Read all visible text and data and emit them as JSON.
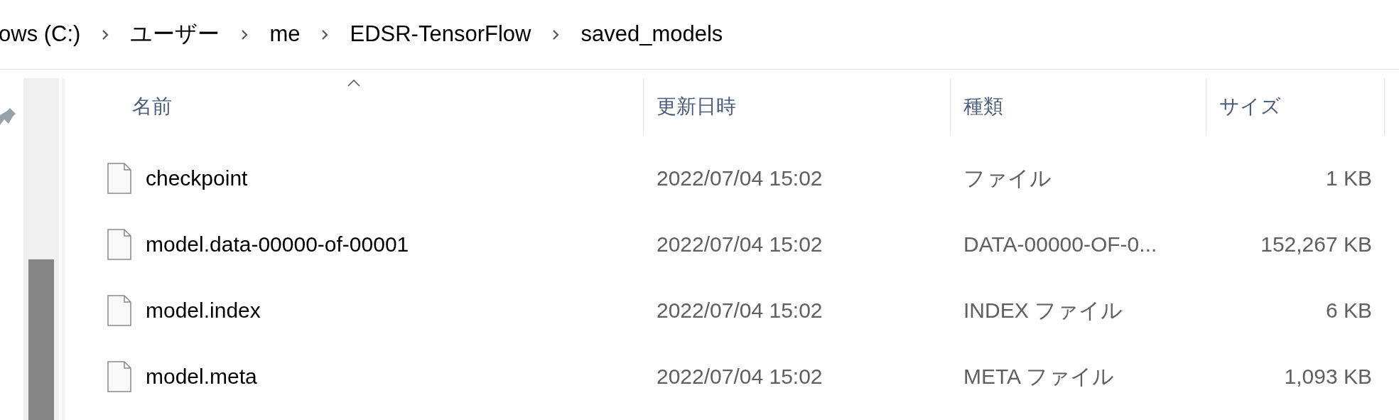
{
  "breadcrumb": [
    "ows (C:)",
    "ユーザー",
    "me",
    "EDSR-TensorFlow",
    "saved_models"
  ],
  "columns": [
    {
      "label": "名前",
      "sorted": true
    },
    {
      "label": "更新日時",
      "sorted": false
    },
    {
      "label": "種類",
      "sorted": false
    },
    {
      "label": "サイズ",
      "sorted": false
    }
  ],
  "files": [
    {
      "name": "checkpoint",
      "modified": "2022/07/04 15:02",
      "type": "ファイル",
      "size": "1 KB"
    },
    {
      "name": "model.data-00000-of-00001",
      "modified": "2022/07/04 15:02",
      "type": "DATA-00000-OF-0...",
      "size": "152,267 KB"
    },
    {
      "name": "model.index",
      "modified": "2022/07/04 15:02",
      "type": "INDEX ファイル",
      "size": "6 KB"
    },
    {
      "name": "model.meta",
      "modified": "2022/07/04 15:02",
      "type": "META ファイル",
      "size": "1,093 KB"
    }
  ]
}
